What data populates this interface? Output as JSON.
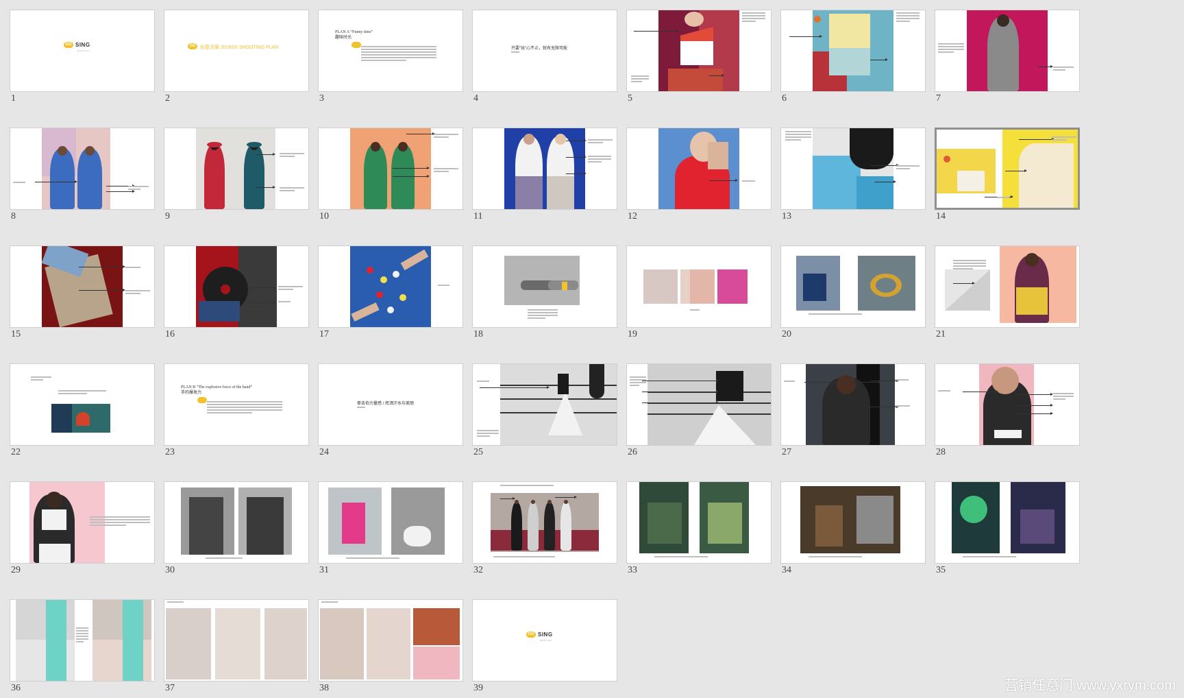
{
  "slides": [
    {
      "number": "1"
    },
    {
      "number": "2"
    },
    {
      "number": "3"
    },
    {
      "number": "4"
    },
    {
      "number": "5"
    },
    {
      "number": "6"
    },
    {
      "number": "7"
    },
    {
      "number": "8"
    },
    {
      "number": "9"
    },
    {
      "number": "10"
    },
    {
      "number": "11"
    },
    {
      "number": "12"
    },
    {
      "number": "13"
    },
    {
      "number": "14"
    },
    {
      "number": "15"
    },
    {
      "number": "16"
    },
    {
      "number": "17"
    },
    {
      "number": "18"
    },
    {
      "number": "19"
    },
    {
      "number": "20"
    },
    {
      "number": "21"
    },
    {
      "number": "22"
    },
    {
      "number": "23"
    },
    {
      "number": "24"
    },
    {
      "number": "25"
    },
    {
      "number": "26"
    },
    {
      "number": "27"
    },
    {
      "number": "28"
    },
    {
      "number": "29"
    },
    {
      "number": "30"
    },
    {
      "number": "31"
    },
    {
      "number": "32"
    },
    {
      "number": "33"
    },
    {
      "number": "34"
    },
    {
      "number": "35"
    },
    {
      "number": "36"
    },
    {
      "number": "37"
    },
    {
      "number": "38"
    },
    {
      "number": "39"
    }
  ],
  "selected_slide": "14",
  "text": {
    "logo_badge": "GO",
    "logo_name": "SING",
    "logo_sub": "DESIGN",
    "slide2_title": "创意方案 2018SS SHOOTING PLAN",
    "slide3_plan_en": "PLAN A  “Funny time”",
    "slide3_plan_cn": "趣味时光",
    "slide4_title": "只要“玩”心不止，就有无限可能",
    "slide23_plan_en": "PLAN B  “The explosive force of the hand”",
    "slide23_plan_cn": "手的爆发力",
    "slide24_title": "拳击伯力量感 / 挥洒汗水与美丽",
    "watermark": "营销任意门 www.yxrym.com"
  },
  "colors": {
    "background": "#e6e6e6",
    "accent_yellow": "#f2c12e",
    "selection_border": "#8f8f8f"
  }
}
